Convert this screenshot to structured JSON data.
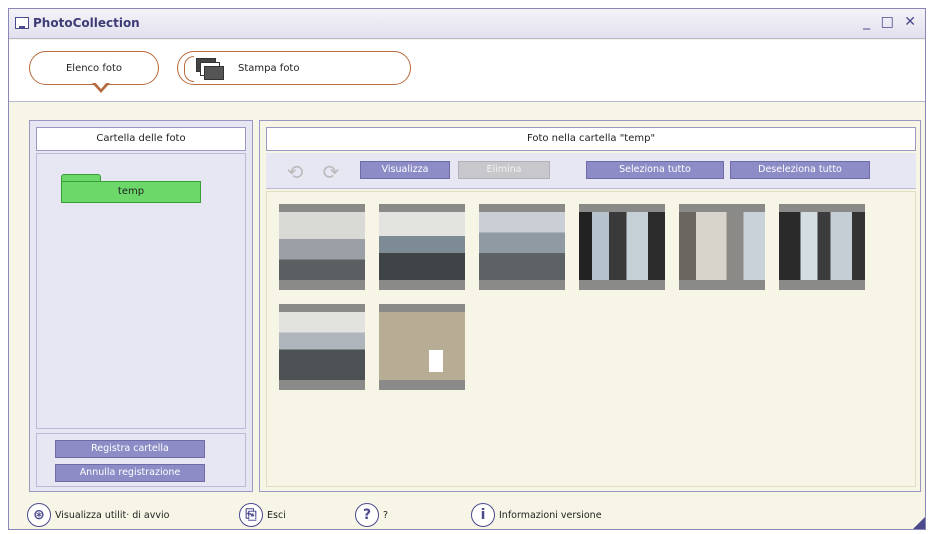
{
  "window": {
    "title": "PhotoCollection",
    "controls": [
      "_",
      "□",
      "✕"
    ]
  },
  "tabs": [
    {
      "label": "Elenco foto",
      "active": true
    },
    {
      "label": "Stampa foto",
      "active": false
    }
  ],
  "left_panel": {
    "header": "Cartella delle foto",
    "folders": [
      {
        "name": "temp"
      }
    ],
    "register_button": "Registra cartella",
    "unregister_button": "Annulla registrazione"
  },
  "right_panel": {
    "header": "Foto nella cartella \"temp\"",
    "toolbar": {
      "view_button": "Visualizza",
      "delete_button": "Elimina",
      "select_all_button": "Seleziona tutto",
      "deselect_all_button": "Deseleziona tutto"
    },
    "photo_count": 8
  },
  "bottom_bar": {
    "startup_utility": "Visualizza utilit· di avvio",
    "exit": "Esci",
    "help": "?",
    "version_info": "Informazioni versione"
  },
  "colors": {
    "accent": "#8e8cc6",
    "folder_green": "#6cd86a",
    "tab_border": "#b76a3c",
    "panel_bg": "#e7e6f3",
    "content_bg": "#f6f5e6"
  }
}
